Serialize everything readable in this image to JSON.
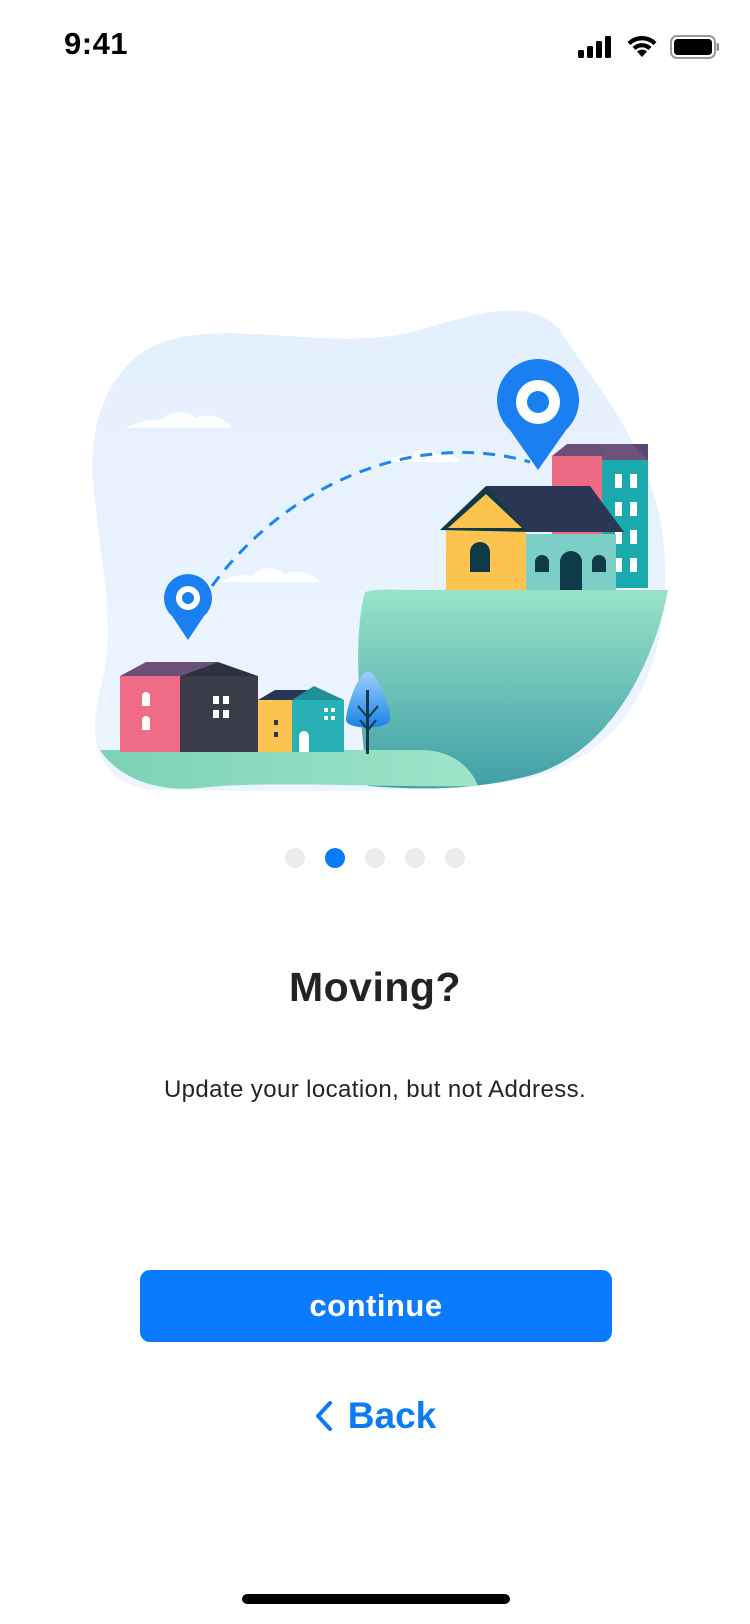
{
  "status_bar": {
    "time": "9:41",
    "icons": [
      "signal-icon",
      "wifi-icon",
      "battery-icon"
    ]
  },
  "illustration": {
    "name": "moving-houses-illustration"
  },
  "pagination": {
    "total": 5,
    "active_index": 1
  },
  "onboarding": {
    "title": "Moving?",
    "subtitle": "Update your location, but not Address."
  },
  "actions": {
    "continue_label": "continue",
    "back_label": "Back"
  },
  "colors": {
    "accent": "#0a7bff",
    "text": "#222326",
    "dot_inactive": "#ebebeb"
  }
}
